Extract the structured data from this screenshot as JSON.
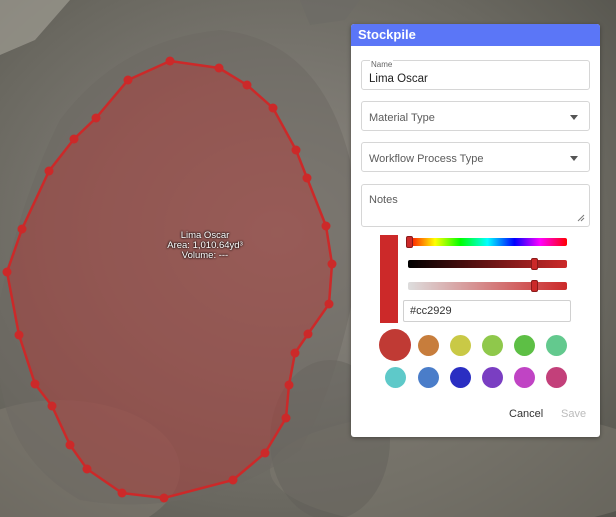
{
  "stockpile": {
    "name": "Lima Oscar",
    "area": "Area: 1,010.64yd³",
    "volume": "Volume: ---",
    "color": "#cc2929"
  },
  "panel": {
    "title": "Stockpile",
    "name_label": "Name",
    "name_value": "Lima Oscar",
    "material_type_placeholder": "Material Type",
    "workflow_placeholder": "Workflow Process Type",
    "notes_placeholder": "Notes",
    "hex_value": "#cc2929",
    "cancel_label": "Cancel",
    "save_label": "Save"
  },
  "palette": {
    "row1": [
      "#c03a34",
      "#c77d3c",
      "#c9c946",
      "#8fc84b",
      "#5dbf45",
      "#63c98e"
    ],
    "row2": [
      "#5ec9c9",
      "#4a7dc9",
      "#2a2ec2",
      "#7a3ec2",
      "#c044c4",
      "#c3407a"
    ]
  }
}
